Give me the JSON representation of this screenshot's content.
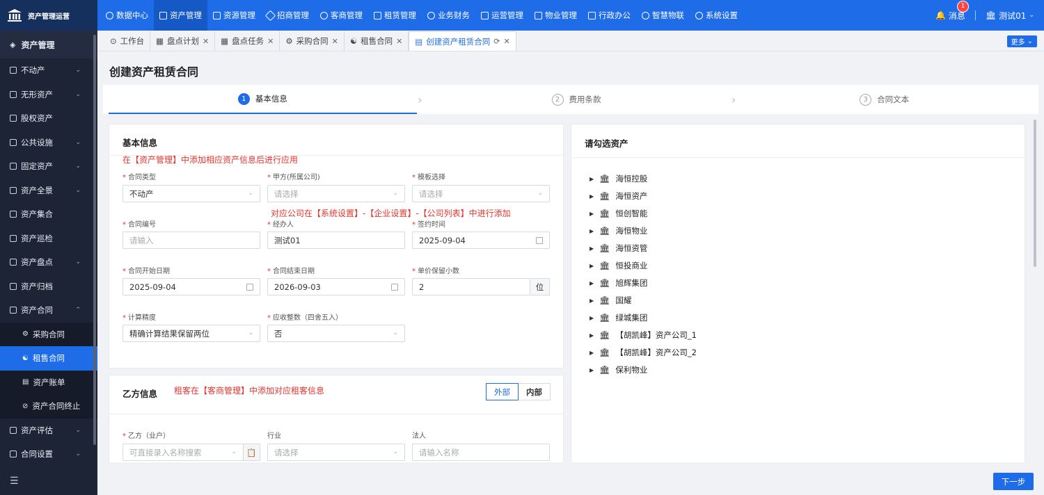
{
  "app": {
    "title": "资产管理运营"
  },
  "topnav": {
    "items": [
      {
        "label": "数据中心"
      },
      {
        "label": "资产管理"
      },
      {
        "label": "资源管理"
      },
      {
        "label": "招商管理"
      },
      {
        "label": "客商管理"
      },
      {
        "label": "租赁管理"
      },
      {
        "label": "业务财务"
      },
      {
        "label": "运营管理"
      },
      {
        "label": "物业管理"
      },
      {
        "label": "行政办公"
      },
      {
        "label": "智慧物联"
      },
      {
        "label": "系统设置"
      }
    ],
    "messages_label": "消息",
    "messages_count": "1",
    "user": "测试01"
  },
  "sidebar": {
    "header": "资产管理",
    "items": [
      {
        "label": "不动产",
        "chev": "⌄"
      },
      {
        "label": "无形资产",
        "chev": "⌄"
      },
      {
        "label": "股权资产",
        "chev": ""
      },
      {
        "label": "公共设施",
        "chev": "⌄"
      },
      {
        "label": "固定资产",
        "chev": "⌄"
      },
      {
        "label": "资产全景",
        "chev": "⌄"
      },
      {
        "label": "资产集合",
        "chev": ""
      },
      {
        "label": "资产巡检",
        "chev": ""
      },
      {
        "label": "资产盘点",
        "chev": "⌄"
      },
      {
        "label": "资产归档",
        "chev": ""
      },
      {
        "label": "资产合同",
        "chev": "⌃"
      }
    ],
    "sub_items": [
      {
        "label": "采购合同"
      },
      {
        "label": "租售合同"
      },
      {
        "label": "资产账单"
      },
      {
        "label": "资产合同终止"
      }
    ],
    "bottom_items": [
      {
        "label": "资产评估",
        "chev": "⌄"
      },
      {
        "label": "合同设置",
        "chev": "⌄"
      }
    ]
  },
  "tabs": [
    {
      "label": "工作台"
    },
    {
      "label": "盘点计划"
    },
    {
      "label": "盘点任务"
    },
    {
      "label": "采购合同"
    },
    {
      "label": "租售合同"
    },
    {
      "label": "创建资产租赁合同"
    }
  ],
  "more_label": "更多",
  "page_title": "创建资产租赁合同",
  "steps": [
    {
      "num": "1",
      "label": "基本信息"
    },
    {
      "num": "2",
      "label": "费用条款"
    },
    {
      "num": "3",
      "label": "合同文本"
    }
  ],
  "basic": {
    "title": "基本信息",
    "note1": "在【资产管理】中添加相应资产信息后进行应用",
    "note2": "对应公司在【系统设置】-【企业设置】-【公司列表】中进行添加",
    "fields": {
      "contract_type": {
        "label": "合同类型",
        "value": "不动产"
      },
      "party_a": {
        "label": "甲方(所属公司)",
        "placeholder": "请选择"
      },
      "template": {
        "label": "模板选择",
        "placeholder": "请选择"
      },
      "contract_no": {
        "label": "合同编号",
        "placeholder": "请输入"
      },
      "handler": {
        "label": "经办人",
        "value": "测试01"
      },
      "sign_date": {
        "label": "签约时间",
        "value": "2025-09-04"
      },
      "start_date": {
        "label": "合同开始日期",
        "value": "2025-09-04"
      },
      "end_date": {
        "label": "合同结束日期",
        "value": "2026-09-03"
      },
      "decimals": {
        "label": "单价保留小数",
        "value": "2",
        "unit": "位"
      },
      "precision": {
        "label": "计算精度",
        "value": "精确计算结果保留两位"
      },
      "round": {
        "label": "应收整数（四舍五入）",
        "value": "否"
      }
    }
  },
  "party_b": {
    "title": "乙方信息",
    "note": "租客在【客商管理】中添加对应租客信息",
    "seg_external": "外部",
    "seg_internal": "内部",
    "fields": {
      "party": {
        "label": "乙方（业户）",
        "placeholder": "可直接录入名称搜索"
      },
      "industry": {
        "label": "行业",
        "placeholder": "请选择"
      },
      "legal": {
        "label": "法人",
        "placeholder": "请输入名称"
      }
    }
  },
  "assets": {
    "title": "请勾选资产",
    "tree": [
      "海恒控股",
      "海恒资产",
      "恒创智能",
      "海恒物业",
      "海恒资管",
      "恒投商业",
      "旭辉集团",
      "国耀",
      "绿城集团",
      "【胡凯峰】资产公司_1",
      "【胡凯峰】资产公司_2",
      "保利物业"
    ]
  },
  "next_button": "下一步"
}
